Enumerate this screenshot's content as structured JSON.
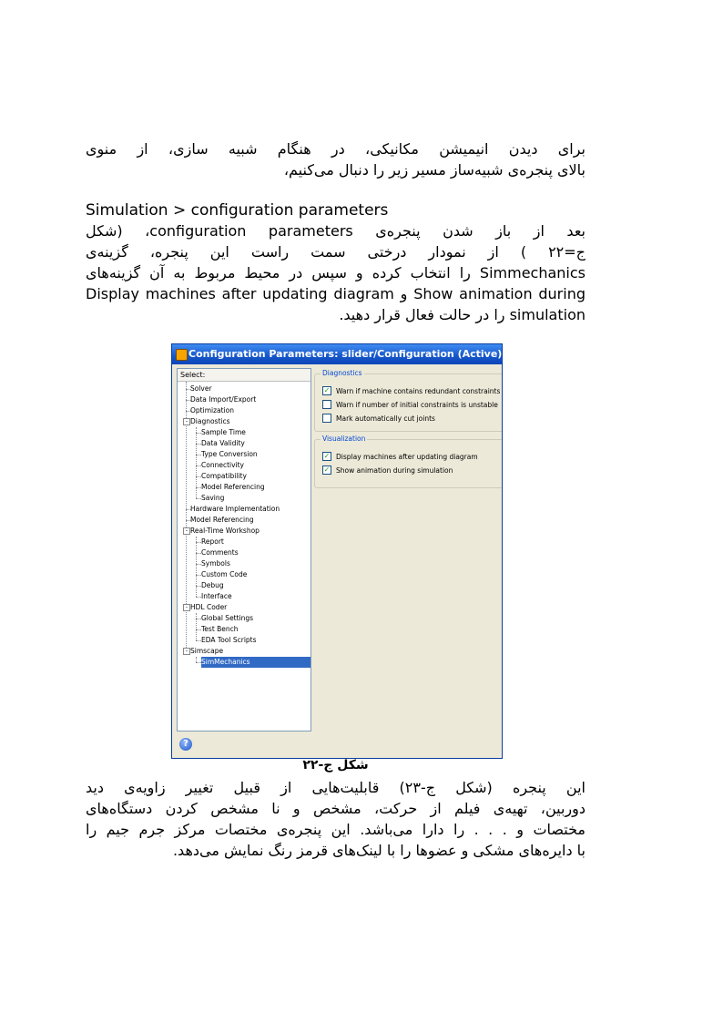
{
  "para1": {
    "lines": [
      "برای دیدن انیمیشن مکانیکی، در هنگام شبیه سازی، از منوی",
      "بالای پنجره‌ی شبیه‌ساز مسیر زیر را دنبال می‌کنیم،"
    ]
  },
  "menu_path": "Simulation > configuration parameters",
  "para2": {
    "lines": [
      "بعد از باز شدن پنجره‌ی configuration  parameters، (شکل",
      "ج=۲۲ ) از نمودار درختی سمت راست این پنجره، گزینه‌ی",
      "Simmechanics را انتخاب کرده و سپس در محیط مربوط به آن گزینه‌های",
      "Show animation during  و  Display machines after updating diagram",
      "simulation را در حالت فعال قرار دهید."
    ]
  },
  "window": {
    "title": "Configuration Parameters: slider/Configuration (Active)",
    "select_label": "Select:",
    "tree": [
      {
        "label": "Solver",
        "level": 1
      },
      {
        "label": "Data Import/Export",
        "level": 1
      },
      {
        "label": "Optimization",
        "level": 1
      },
      {
        "label": "Diagnostics",
        "level": 1,
        "expander": "-"
      },
      {
        "label": "Sample Time",
        "level": 2
      },
      {
        "label": "Data Validity",
        "level": 2
      },
      {
        "label": "Type Conversion",
        "level": 2
      },
      {
        "label": "Connectivity",
        "level": 2
      },
      {
        "label": "Compatibility",
        "level": 2
      },
      {
        "label": "Model Referencing",
        "level": 2
      },
      {
        "label": "Saving",
        "level": 2
      },
      {
        "label": "Hardware Implementation",
        "level": 1
      },
      {
        "label": "Model Referencing",
        "level": 1
      },
      {
        "label": "Real-Time Workshop",
        "level": 1,
        "expander": "-"
      },
      {
        "label": "Report",
        "level": 2
      },
      {
        "label": "Comments",
        "level": 2
      },
      {
        "label": "Symbols",
        "level": 2
      },
      {
        "label": "Custom Code",
        "level": 2
      },
      {
        "label": "Debug",
        "level": 2
      },
      {
        "label": "Interface",
        "level": 2
      },
      {
        "label": "HDL Coder",
        "level": 1,
        "expander": "-"
      },
      {
        "label": "Global Settings",
        "level": 2
      },
      {
        "label": "Test Bench",
        "level": 2
      },
      {
        "label": "EDA Tool Scripts",
        "level": 2
      },
      {
        "label": "Simscape",
        "level": 1,
        "expander": "-"
      },
      {
        "label": "SimMechanics",
        "level": 2,
        "selected": true
      }
    ],
    "diagnostics": {
      "title": "Diagnostics",
      "options": [
        {
          "label": "Warn if machine contains redundant constraints",
          "checked": true
        },
        {
          "label": "Warn if number of initial constraints is unstable",
          "checked": false
        },
        {
          "label": "Mark automatically cut joints",
          "checked": false
        }
      ]
    },
    "visualization": {
      "title": "Visualization",
      "options": [
        {
          "label": "Display machines after updating diagram",
          "checked": true
        },
        {
          "label": "Show animation during simulation",
          "checked": true
        }
      ]
    },
    "help_glyph": "?"
  },
  "caption": "شکل ج-۲۲",
  "para3": {
    "lines": [
      "این پنجره (شکل ج-۲۳) قابلیت‌هایی از قبیل  تغییر زاویه‌ی دید",
      "دوربین، تهیه‌ی فیلم از حرکت، مشخص و نا مشخص کردن دستگاه‌های",
      "مختصات و . . . را دارا می‌باشد. این پنجره‌ی مختصات مرکز جرم جیم را",
      "با دایره‌های مشکی و عضوها را با لینک‌های قرمز رنگ نمایش می‌دهد."
    ]
  }
}
